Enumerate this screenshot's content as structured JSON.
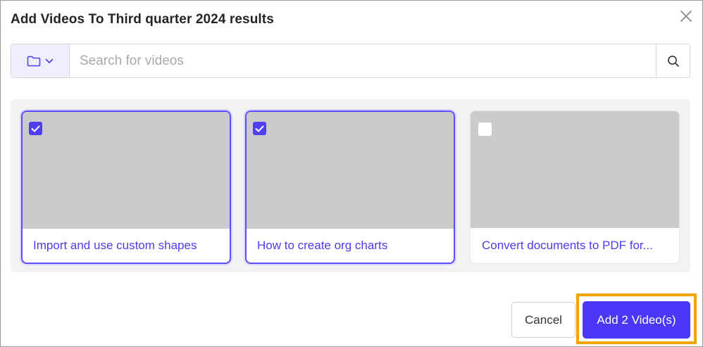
{
  "dialog": {
    "title": "Add Videos To Third quarter 2024 results"
  },
  "search": {
    "placeholder": "Search for videos",
    "value": ""
  },
  "icons": {
    "close": "close-icon",
    "folder": "folder-icon",
    "chevron": "chevron-down-icon",
    "search": "search-icon",
    "check": "check-icon"
  },
  "videos": [
    {
      "title": "Import and use custom shapes",
      "selected": true
    },
    {
      "title": "How to create org charts",
      "selected": true
    },
    {
      "title": "Convert documents to PDF for...",
      "selected": false
    }
  ],
  "footer": {
    "cancel_label": "Cancel",
    "add_label": "Add 2 Video(s)"
  },
  "colors": {
    "accent": "#4b37f5",
    "highlight": "#f5a300",
    "thumbnail": "#cbcbcb"
  }
}
